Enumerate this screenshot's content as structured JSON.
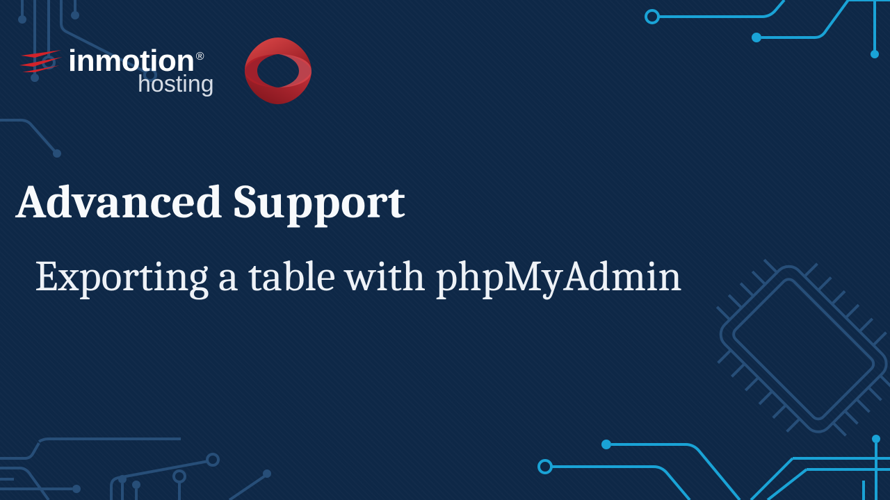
{
  "brand": {
    "name": "inmotion",
    "registered": "®",
    "subname": "hosting"
  },
  "headline": {
    "title": "Advanced Support",
    "subtitle": "Exporting a table with phpMyAdmin"
  }
}
